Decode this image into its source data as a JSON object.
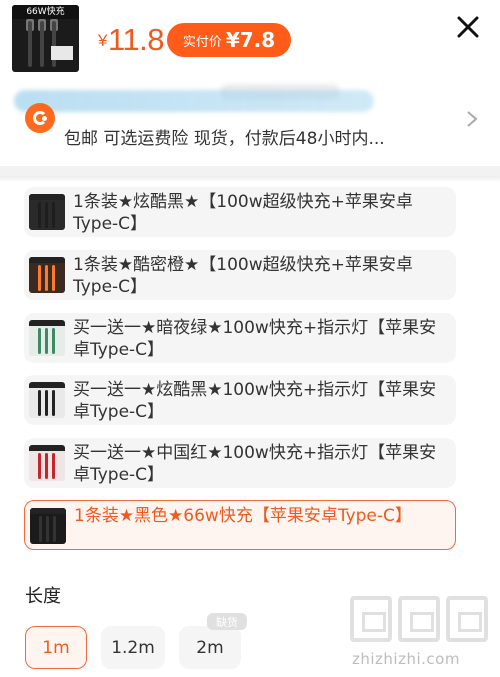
{
  "header": {
    "thumb_tag": "66W快充",
    "price_symbol": "¥",
    "price": "11.8",
    "real_price_label": "实付价",
    "real_price_value": "¥7.8"
  },
  "shipping": {
    "text": "包邮  可选运费险  现货，付款后48小时内..."
  },
  "options": [
    {
      "label": "1条装★炫酷黑★【100w超级快充+苹果安卓Type-C】",
      "cable_color": "#1e1e1e",
      "img_bg": "#2a2a2a"
    },
    {
      "label": "1条装★酷密橙★【100w超级快充+苹果安卓Type-C】",
      "cable_color": "#ff7a2a",
      "img_bg": "#3a2a22"
    },
    {
      "label": "买一送一★暗夜绿★100w快充+指示灯【苹果安卓Type-C】",
      "cable_color": "#3e8a66",
      "img_bg": "#e6ece8"
    },
    {
      "label": "买一送一★炫酷黑★100w快充+指示灯【苹果安卓Type-C】",
      "cable_color": "#222222",
      "img_bg": "#e9e9e9"
    },
    {
      "label": "买一送一★中国红★100w快充+指示灯【苹果安卓Type-C】",
      "cable_color": "#c8242a",
      "img_bg": "#eee6e6"
    },
    {
      "label": "1条装★黑色★66w快充【苹果安卓Type-C】",
      "cable_color": "#333333",
      "img_bg": "#1b1b1b",
      "selected": true
    }
  ],
  "length": {
    "title": "长度",
    "options": [
      "1m",
      "1.2m",
      "2m"
    ],
    "selected": "1m",
    "sold_out_badge": "缺货"
  },
  "watermark": {
    "text": "zhizhizhi.com"
  },
  "colors": {
    "accent": "#f05a1e",
    "accent_bg": "#fff5f0",
    "chip_bg": "#f5f5f5"
  }
}
